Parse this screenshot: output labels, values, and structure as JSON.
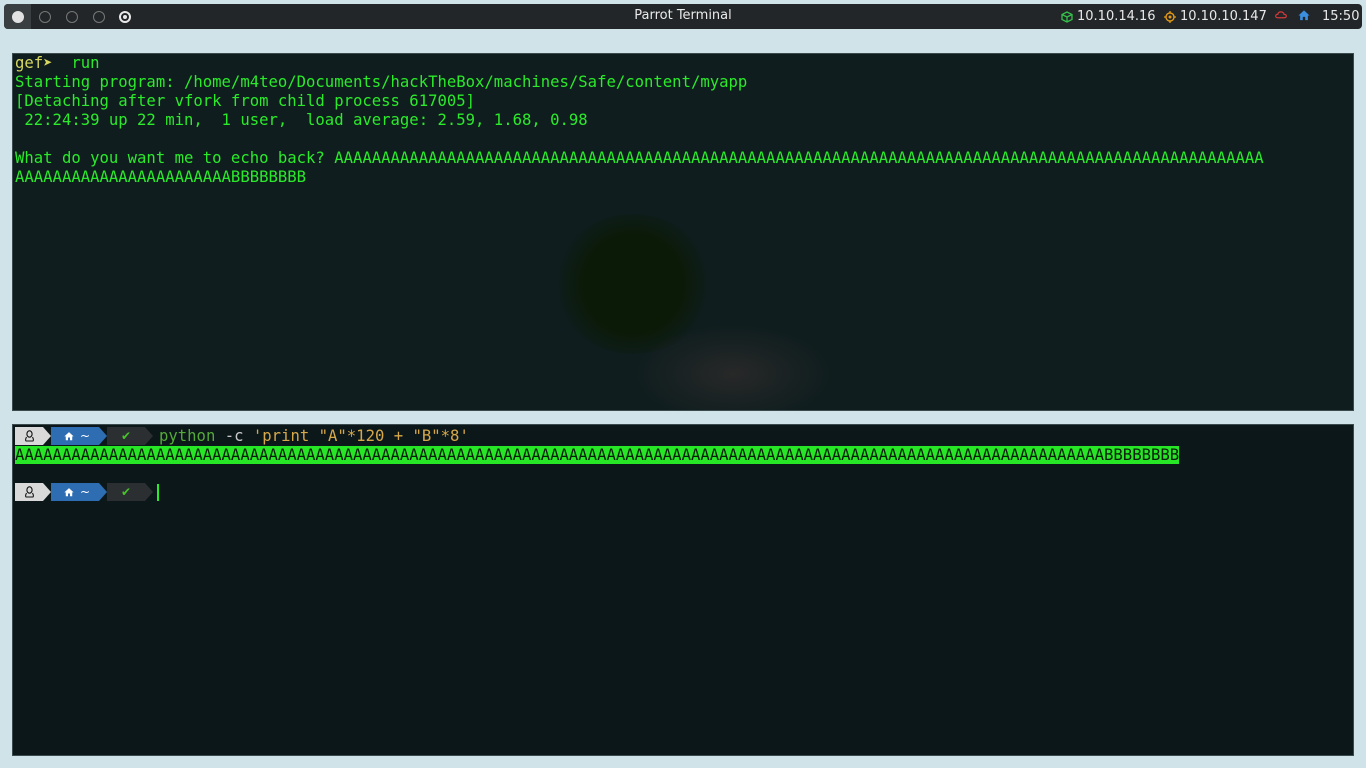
{
  "topbar": {
    "title": "Parrot Terminal",
    "vpn_ip": "10.10.14.16",
    "target_ip": "10.10.10.147",
    "clock": "15:50",
    "colors": {
      "vpn": "#35c04a",
      "target": "#e49a16",
      "cloud": "#d33a3a",
      "home": "#3b8ee0"
    }
  },
  "top_pane": {
    "prompt": "gef➤",
    "command": "run",
    "lines": [
      "Starting program: /home/m4teo/Documents/hackTheBox/machines/Safe/content/myapp",
      "[Detaching after vfork from child process 617005]",
      " 22:24:39 up 22 min,  1 user,  load average: 2.59, 1.68, 0.98",
      "",
      "What do you want me to echo back? AAAAAAAAAAAAAAAAAAAAAAAAAAAAAAAAAAAAAAAAAAAAAAAAAAAAAAAAAAAAAAAAAAAAAAAAAAAAAAAAAAAAAAAAAAAAAAAAAAA",
      "AAAAAAAAAAAAAAAAAAAAAAABBBBBBBB"
    ]
  },
  "bottom_pane": {
    "prompt1": {
      "dir": "~",
      "status": "✔",
      "cmd_program": "python",
      "cmd_flag": "-c",
      "cmd_arg": "'print \"A\"*120 + \"B\"*8'"
    },
    "output": "AAAAAAAAAAAAAAAAAAAAAAAAAAAAAAAAAAAAAAAAAAAAAAAAAAAAAAAAAAAAAAAAAAAAAAAAAAAAAAAAAAAAAAAAAAAAAAAAAAAAAAAAAAAAAAAAAAAABBBBBBBB",
    "prompt2": {
      "dir": "~",
      "status": "✔"
    }
  },
  "icons": [
    "vpn-cube-icon",
    "target-crosshair-icon",
    "cloud-icon",
    "home-icon",
    "tux-icon",
    "checkmark-icon"
  ]
}
